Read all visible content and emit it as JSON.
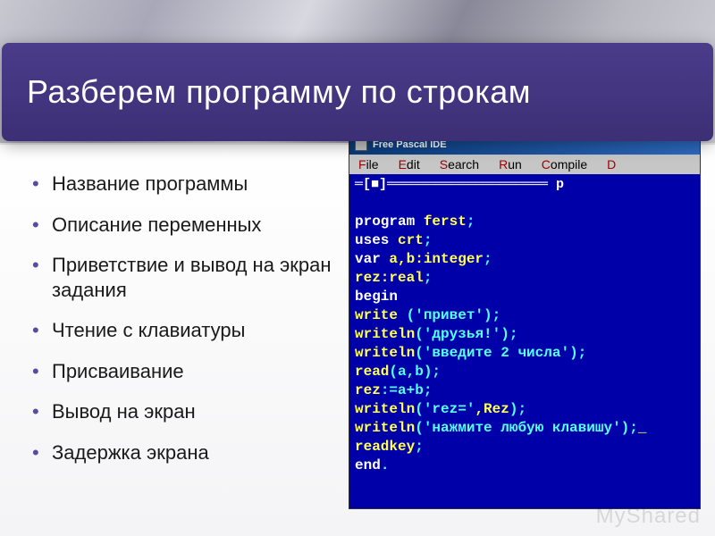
{
  "title": "Разберем программу по строкам",
  "bullets": [
    "Название программы",
    "Описание переменных",
    "Приветствие и вывод на экран задания",
    "Чтение с клавиатуры",
    "Присваивание",
    "Вывод на экран",
    "Задержка экрана"
  ],
  "ide": {
    "titlebar": "Free Pascal IDE",
    "menu": {
      "file": "File",
      "edit": "Edit",
      "search": "Search",
      "run": "Run",
      "compile": "Compile",
      "d": "D"
    },
    "frame_decor": "═[■]════════════════════ p",
    "code": {
      "l1_kw": "program",
      "l1_id": " ferst",
      "l1_p": ";",
      "l2_kw": "uses",
      "l2_id": " crt",
      "l2_p": ";",
      "l3_kw": "var",
      "l3_id": " a,b:integer",
      "l3_p": ";",
      "l4_id": "rez:real",
      "l4_p": ";",
      "l5_kw": "begin",
      "l6_id": "write",
      "l6_a": " (",
      "l6_s": "'привет'",
      "l6_b": ");",
      "l7_id": "writeln",
      "l7_a": "(",
      "l7_s": "'друзья!'",
      "l7_b": ");",
      "l8_id": "writeln",
      "l8_a": "(",
      "l8_s": "'введите 2 числа'",
      "l8_b": ");",
      "l9_id": "read",
      "l9_a": "(a,b);",
      "l10_id": "rez",
      "l10_op": ":=a+b;",
      "l11_id": "writeln",
      "l11_a": "(",
      "l11_s": "'rez='",
      "l11_c": ",Rez",
      "l11_b": ");",
      "l12_id": "writeln",
      "l12_a": "(",
      "l12_s": "'нажмите любую клавишу'",
      "l12_b": ");",
      "l12_cur": "_",
      "l13_id": "readkey",
      "l13_p": ";",
      "l14_kw": "end",
      "l14_p": "."
    }
  },
  "watermark": {
    "my": "My",
    "shared": "Shared"
  }
}
